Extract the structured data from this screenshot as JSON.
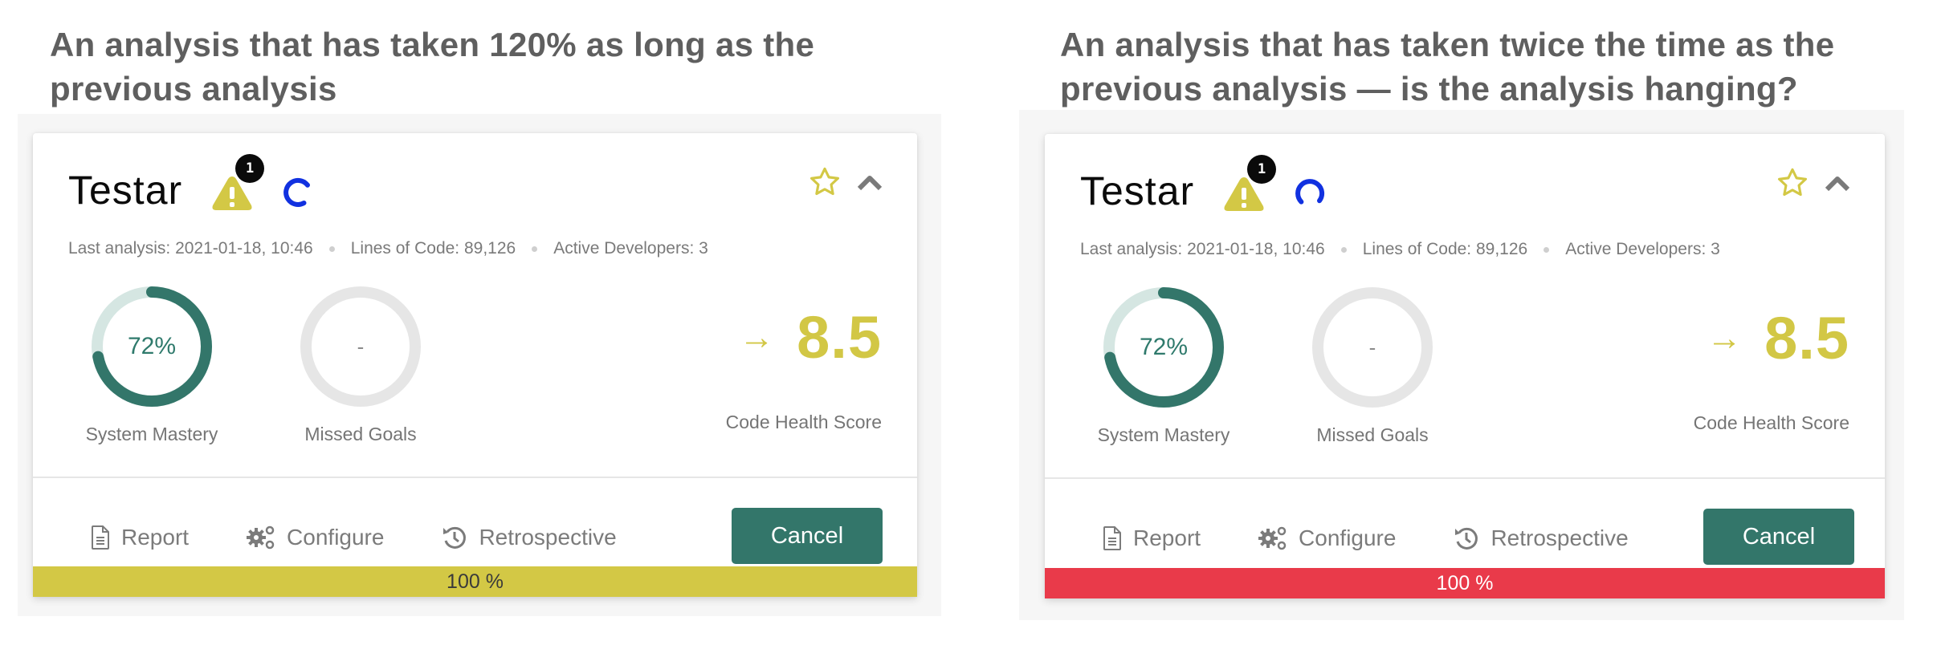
{
  "captions": {
    "left": "An analysis that has taken 120% as long as the previous analysis",
    "right": "An analysis that has taken twice the time as the previous analysis — is the analysis hanging?"
  },
  "cards": [
    {
      "project_name": "Testar",
      "warning_count": "1",
      "meta": {
        "last_analysis": "Last analysis: 2021-01-18, 10:46",
        "lines_of_code": "Lines of Code: 89,126",
        "active_developers": "Active Developers: 3"
      },
      "system_mastery": {
        "value_text": "72%",
        "value": 0.72,
        "label": "System Mastery"
      },
      "missed_goals": {
        "value_text": "-",
        "label": "Missed Goals"
      },
      "code_health": {
        "trend_icon": "arrow-right-icon",
        "trend_glyph": "→",
        "score": "8.5",
        "label": "Code Health Score"
      },
      "actions": {
        "report": "Report",
        "configure": "Configure",
        "retrospective": "Retrospective",
        "cancel": "Cancel"
      },
      "progress": {
        "value": 1.0,
        "text": "100 %",
        "color": "#d3c845",
        "text_color": "#3a3a3a"
      },
      "spinner_color": "#1131e0"
    },
    {
      "project_name": "Testar",
      "warning_count": "1",
      "meta": {
        "last_analysis": "Last analysis: 2021-01-18, 10:46",
        "lines_of_code": "Lines of Code: 89,126",
        "active_developers": "Active Developers: 3"
      },
      "system_mastery": {
        "value_text": "72%",
        "value": 0.72,
        "label": "System Mastery"
      },
      "missed_goals": {
        "value_text": "-",
        "label": "Missed Goals"
      },
      "code_health": {
        "trend_icon": "arrow-right-icon",
        "trend_glyph": "→",
        "score": "8.5",
        "label": "Code Health Score"
      },
      "actions": {
        "report": "Report",
        "configure": "Configure",
        "retrospective": "Retrospective",
        "cancel": "Cancel"
      },
      "progress": {
        "value": 1.0,
        "text": "100 %",
        "color": "#e93a4a",
        "text_color": "#ffffff"
      },
      "spinner_color": "#1131e0"
    }
  ],
  "colors": {
    "accent_green": "#33766a",
    "warning_yellow": "#d3c845",
    "ring_track_light": "#d5e6e2",
    "ring_empty": "#e6e6e6"
  }
}
